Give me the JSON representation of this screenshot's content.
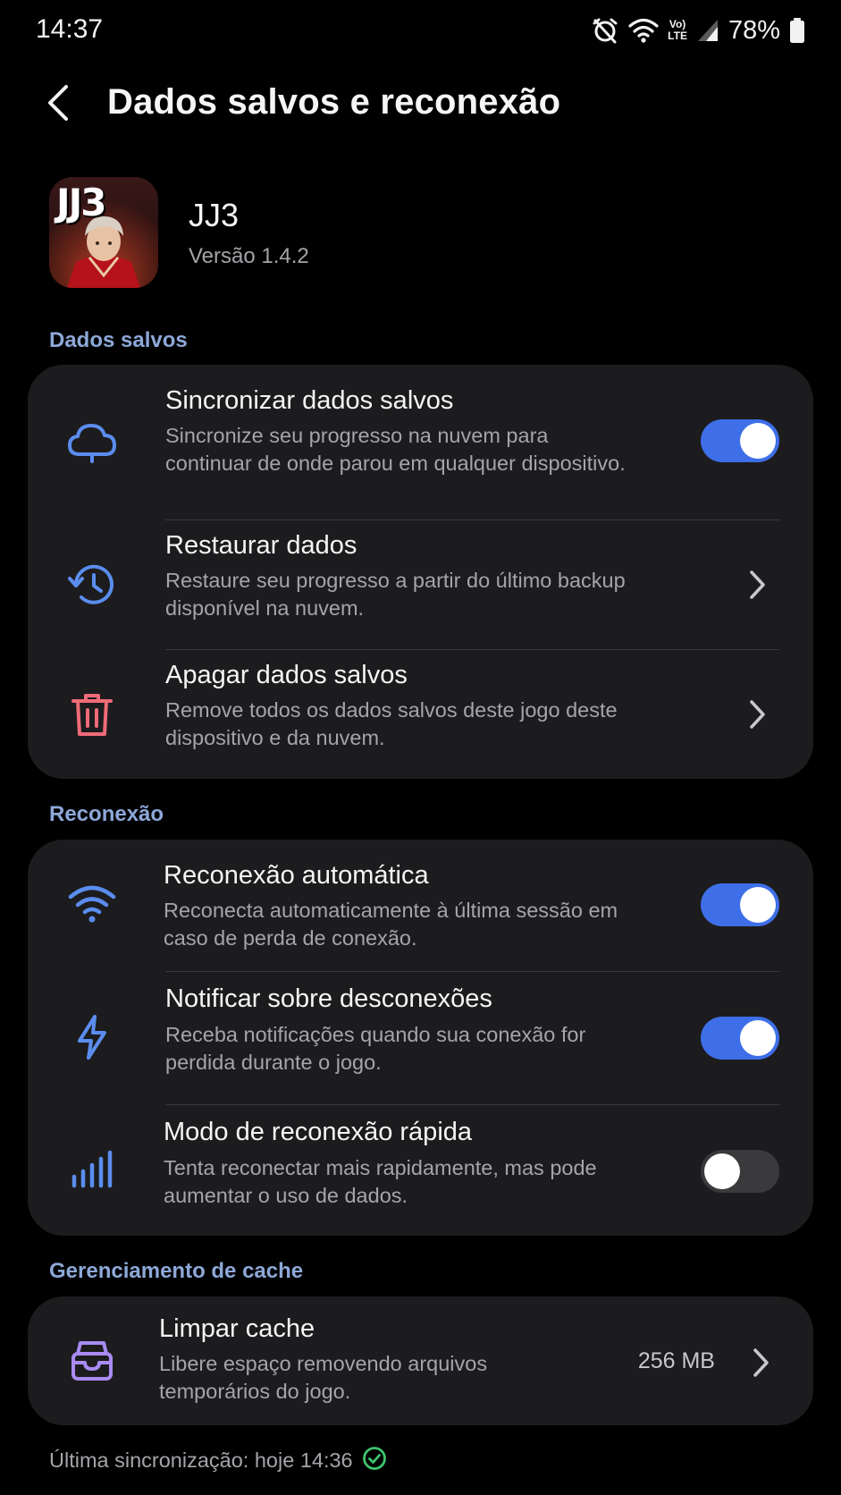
{
  "status_bar": {
    "time": "14:37",
    "battery_percent": "78%",
    "icons": [
      "alarm-muted-icon",
      "wifi-icon",
      "volte-icon",
      "signal-icon",
      "battery-icon"
    ],
    "volte_line1": "Vo)",
    "volte_line2": "LTE"
  },
  "header": {
    "title": "Dados salvos e reconexão"
  },
  "app": {
    "name": "JJ3",
    "version": "Versão 1.4.2",
    "icon_text": "JJ3"
  },
  "sections": {
    "saved_data": {
      "title": "Dados salvos",
      "items": [
        {
          "title": "Sincronizar dados salvos",
          "description": "Sincronize seu progresso na nuvem para continuar de onde parou em qualquer dispositivo.",
          "icon": "cloud-icon",
          "control": "toggle",
          "enabled": true
        },
        {
          "title": "Restaurar dados",
          "description": "Restaure seu progresso a partir do último backup disponível na nuvem.",
          "icon": "restore-history-icon",
          "control": "chevron"
        },
        {
          "title": "Apagar dados salvos",
          "description": "Remove todos os dados salvos deste jogo deste dispositivo e da nuvem.",
          "icon": "trash-icon",
          "control": "chevron"
        }
      ]
    },
    "reconnection": {
      "title": "Reconexão",
      "items": [
        {
          "title": "Reconexão automática",
          "description": "Reconecta automaticamente à última sessão em caso de perda de conexão.",
          "icon": "wifi-icon",
          "control": "toggle",
          "enabled": true
        },
        {
          "title": "Notificar sobre desconexões",
          "description": "Receba notificações quando sua conexão for perdida durante o jogo.",
          "icon": "lightning-icon",
          "control": "toggle",
          "enabled": true
        },
        {
          "title": "Modo de reconexão rápida",
          "description": "Tenta reconectar mais rapidamente, mas pode aumentar o uso de dados.",
          "icon": "signal-bars-icon",
          "control": "toggle",
          "enabled": false
        }
      ]
    },
    "cache": {
      "title": "Gerenciamento de cache",
      "items": [
        {
          "title": "Limpar cache",
          "description": "Libere espaço removendo arquivos temporários do jogo.",
          "icon": "archive-tray-icon",
          "value": "256 MB",
          "control": "chevron"
        }
      ]
    }
  },
  "footer": {
    "last_sync": "Última sincronização: hoje 14:36",
    "icon": "check-circle-icon"
  },
  "colors": {
    "background": "#000000",
    "card": "#1c1c1e",
    "accent_blue": "#3e6fe8",
    "icon_blue": "#5b8def",
    "section_title": "#8da8d8",
    "danger_red": "#f06a78",
    "purple": "#a98bf2",
    "success_green": "#3ec46d"
  }
}
